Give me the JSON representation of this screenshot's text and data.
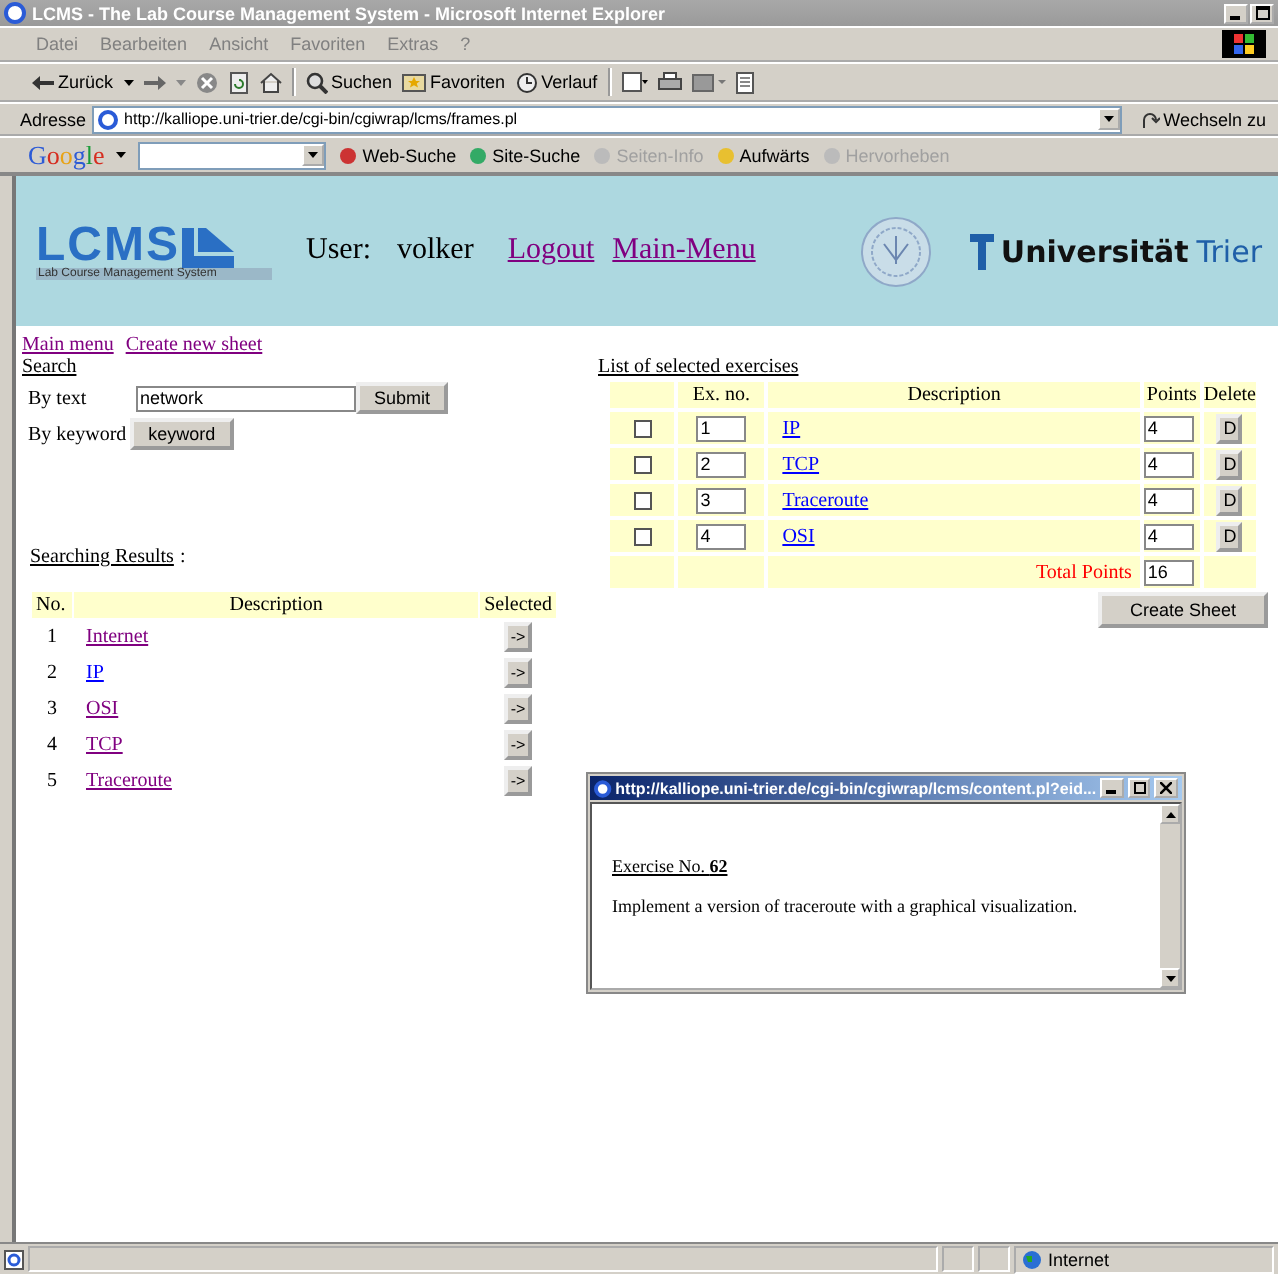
{
  "window": {
    "title": "LCMS - The Lab Course Management System - Microsoft Internet Explorer"
  },
  "menu": [
    "Datei",
    "Bearbeiten",
    "Ansicht",
    "Favoriten",
    "Extras",
    "?"
  ],
  "toolbar": [
    {
      "label": "Zurück"
    },
    {
      "label": "Suchen"
    },
    {
      "label": "Favoriten"
    },
    {
      "label": "Verlauf"
    }
  ],
  "address": {
    "label": "Adresse",
    "url": "http://kalliope.uni-trier.de/cgi-bin/cgiwrap/lcms/frames.pl",
    "go": "Wechseln zu"
  },
  "google_bar": {
    "logo": "Google",
    "items": [
      {
        "label": "Web-Suche",
        "disabled": false
      },
      {
        "label": "Site-Suche",
        "disabled": false
      },
      {
        "label": "Seiten-Info",
        "disabled": true
      },
      {
        "label": "Aufwärts",
        "disabled": false
      },
      {
        "label": "Hervorheben",
        "disabled": true
      }
    ]
  },
  "header": {
    "logo": "LCMS",
    "logo_subtitle": "Lab Course Management System",
    "user_label": "User:",
    "user_name": "volker",
    "links": [
      "Logout",
      "Main-Menu"
    ],
    "university": "Universität",
    "city": "Trier"
  },
  "nav_links": [
    "Main menu",
    "Create new sheet"
  ],
  "search": {
    "title": "Search",
    "by_text_label": "By text",
    "text_value": "network",
    "submit": "Submit",
    "by_keyword_label": "By keyword",
    "keyword_button": "keyword"
  },
  "results": {
    "title": "Searching Results",
    "suffix": ":",
    "columns": [
      "No.",
      "Description",
      "Selected"
    ],
    "rows": [
      {
        "no": "1",
        "description": "Internet",
        "visited": true,
        "action": "->"
      },
      {
        "no": "2",
        "description": "IP",
        "visited": false,
        "action": "->"
      },
      {
        "no": "3",
        "description": "OSI",
        "visited": true,
        "action": "->"
      },
      {
        "no": "4",
        "description": "TCP",
        "visited": true,
        "action": "->"
      },
      {
        "no": "5",
        "description": "Traceroute",
        "visited": true,
        "action": "->"
      }
    ]
  },
  "selected": {
    "title": "List of selected exercises",
    "columns": [
      "Ex. no.",
      "Description",
      "Points",
      "Delete"
    ],
    "rows": [
      {
        "checked": false,
        "ex_no": "1",
        "description": "IP",
        "visited": false,
        "points": "4",
        "delete": "D"
      },
      {
        "checked": false,
        "ex_no": "2",
        "description": "TCP",
        "visited": false,
        "points": "4",
        "delete": "D"
      },
      {
        "checked": false,
        "ex_no": "3",
        "description": "Traceroute",
        "visited": false,
        "points": "4",
        "delete": "D"
      },
      {
        "checked": false,
        "ex_no": "4",
        "description": "OSI",
        "visited": false,
        "points": "4",
        "delete": "D"
      }
    ],
    "total_label": "Total Points",
    "total_value": "16",
    "create_button": "Create Sheet"
  },
  "popup": {
    "title": "http://kalliope.uni-trier.de/cgi-bin/cgiwrap/lcms/content.pl?eid...",
    "heading": "Exercise No. **62**",
    "text": "Implement a version of traceroute with a graphical visualization."
  },
  "status_bar": {
    "zone": "Internet"
  }
}
